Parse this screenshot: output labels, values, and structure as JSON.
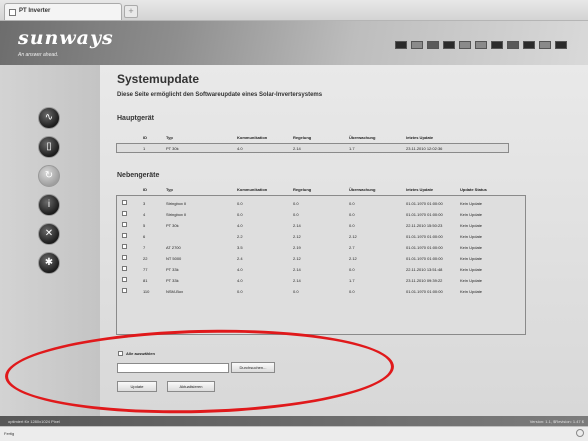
{
  "browser": {
    "tab_title": "PT Inverter",
    "new_tab": "+"
  },
  "header": {
    "brand": "sunways",
    "tagline": "An answer ahead."
  },
  "nav": [
    {
      "name": "nav-dashboard",
      "icon": "wave-icon",
      "glyph": "∿",
      "active": false
    },
    {
      "name": "nav-device",
      "icon": "device-icon",
      "glyph": "▯",
      "active": false
    },
    {
      "name": "nav-update",
      "icon": "refresh-icon",
      "glyph": "↻",
      "active": true
    },
    {
      "name": "nav-info",
      "icon": "info-icon",
      "glyph": "i",
      "active": false
    },
    {
      "name": "nav-settings",
      "icon": "tools-icon",
      "glyph": "✕",
      "active": false
    },
    {
      "name": "nav-network",
      "icon": "network-icon",
      "glyph": "✱",
      "active": false
    }
  ],
  "main": {
    "title": "Systemupdate",
    "subtitle": "Diese Seite ermöglicht den Softwareupdate eines Solar-Invertersystems",
    "main_device": {
      "title": "Hauptgerät",
      "columns": [
        "ID",
        "Typ",
        "Kommunikation",
        "Regelung",
        "Überwachung",
        "letztes Update"
      ],
      "rows": [
        [
          "1",
          "PT 30k",
          "4.0",
          "2.14",
          "1.7",
          "23.11.2010 12:02:36"
        ]
      ]
    },
    "sub_devices": {
      "title": "Nebengeräte",
      "columns": [
        "ID",
        "Typ",
        "Kommunikation",
        "Regelung",
        "Überwachung",
        "letztes Update",
        "Update Status"
      ],
      "rows": [
        [
          "3",
          "Stringbox II",
          "0.0",
          "0.0",
          "0.0",
          "01.01.1970 01:00:00",
          "Kein Update"
        ],
        [
          "4",
          "Stringbox II",
          "0.0",
          "0.0",
          "0.0",
          "01.01.1970 01:00:00",
          "Kein Update"
        ],
        [
          "5",
          "PT 30k",
          "4.0",
          "2.14",
          "0.0",
          "22.11.2010 15:50:23",
          "Kein Update"
        ],
        [
          "6",
          "",
          "2.2",
          "2.12",
          "2.12",
          "01.01.1970 01:00:00",
          "Kein Update"
        ],
        [
          "7",
          "AT 2700",
          "3.5",
          "2.19",
          "2.7",
          "01.01.1970 01:00:00",
          "Kein Update"
        ],
        [
          "22",
          "NT 5000",
          "2.4",
          "2.12",
          "2.12",
          "01.01.1970 01:00:00",
          "Kein Update"
        ],
        [
          "77",
          "PT 33k",
          "4.0",
          "2.14",
          "0.0",
          "22.11.2010 13:51:48",
          "Kein Update"
        ],
        [
          "81",
          "PT 33k",
          "4.0",
          "2.14",
          "1.7",
          "23.11.2010 09:39:22",
          "Kein Update"
        ],
        [
          "110",
          "NSM-Box",
          "0.0",
          "0.0",
          "0.0",
          "01.01.1970 01:00:00",
          "Kein Update"
        ]
      ]
    },
    "select_all_label": "Alle auswählen",
    "file_input_value": "",
    "browse_label": "Durchsuchen...",
    "update_label": "Update",
    "refresh_label": "Aktualisieren"
  },
  "footer": {
    "left": "optimiert für 1280x1024 Pixel",
    "right": "Version: 1.1, $Revision: 1.47 $"
  },
  "statusbar": {
    "left": "Fertig"
  },
  "annotation_color": "#e0191b"
}
